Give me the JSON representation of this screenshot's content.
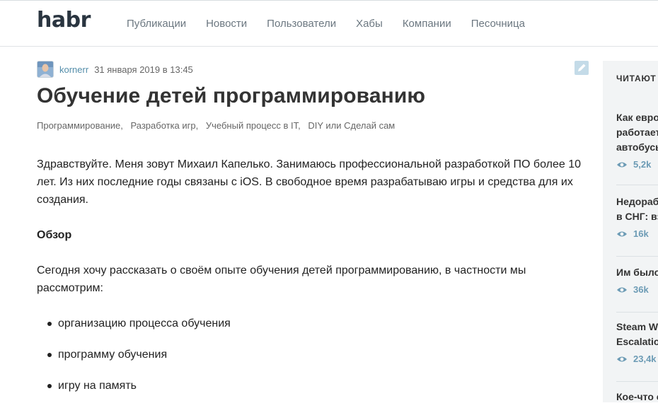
{
  "header": {
    "logo": "habr",
    "nav": [
      "Публикации",
      "Новости",
      "Пользователи",
      "Хабы",
      "Компании",
      "Песочница"
    ]
  },
  "post": {
    "author": "kornerr",
    "date": "31 января 2019 в 13:45",
    "title": "Обучение детей программированию",
    "hubs": [
      "Программирование,",
      "Разработка игр,",
      "Учебный процесс в IT,",
      "DIY или Сделай сам"
    ],
    "paragraph1": "Здравствуйте. Меня зовут Михаил Капелько. Занимаюсь профессиональной разработкой ПО более 10 лет. Из них последние годы связаны с iOS. В свободное время разрабатываю игры и средства для их создания.",
    "overview_heading": "Обзор",
    "paragraph2": "Сегодня хочу рассказать о своём опыте обучения детей программированию, в частности мы рассмотрим:",
    "list": [
      "организацию процесса обучения",
      "программу обучения",
      "игру на память"
    ]
  },
  "sidebar": {
    "title": "ЧИТАЮТ",
    "items": [
      {
        "title": "Как евро\nработает\nавтобусь",
        "views": "5,2k"
      },
      {
        "title": "Недорабо\nв СНГ: взг",
        "views": "16k"
      },
      {
        "title": "Им было",
        "views": "36k"
      },
      {
        "title": "Steam Wi\nEscalation",
        "views": "23,4k"
      },
      {
        "title": "Кое-что о",
        "views": ""
      }
    ]
  },
  "colors": {
    "accent": "#548eaa",
    "views": "#6c9bb5",
    "sidebar_bg": "#f2f4f5"
  }
}
